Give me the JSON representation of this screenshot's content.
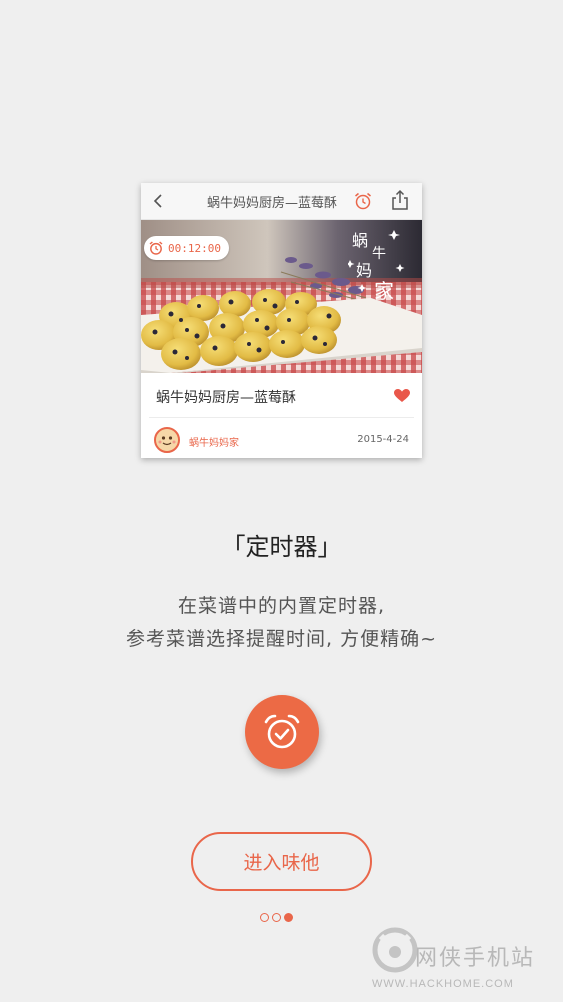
{
  "preview_card": {
    "header_title": "蜗牛妈妈厨房—蓝莓酥",
    "timer_text": "00:12:00",
    "watermark_text": [
      "蜗",
      "牛",
      "妈",
      "家"
    ],
    "recipe_title": "蜗牛妈妈厨房—蓝莓酥",
    "author_name": "蜗牛妈妈家",
    "post_date": "2015-4-24",
    "icons": {
      "back": "back-arrow-icon",
      "alarm": "alarm-clock-icon",
      "share": "share-icon",
      "favorite": "heart-icon"
    }
  },
  "feature": {
    "title": "「定时器」",
    "desc_line1": "在菜谱中的内置定时器,",
    "desc_line2": "参考菜谱选择提醒时间, 方便精确~"
  },
  "cta": {
    "enter_label": "进入味他"
  },
  "pager": {
    "total": 3,
    "current": 3
  },
  "footer": {
    "site_name": "网侠手机站",
    "site_url": "WWW.HACKHOME.COM"
  },
  "colors": {
    "accent": "#e9664a",
    "background": "#efefef"
  }
}
